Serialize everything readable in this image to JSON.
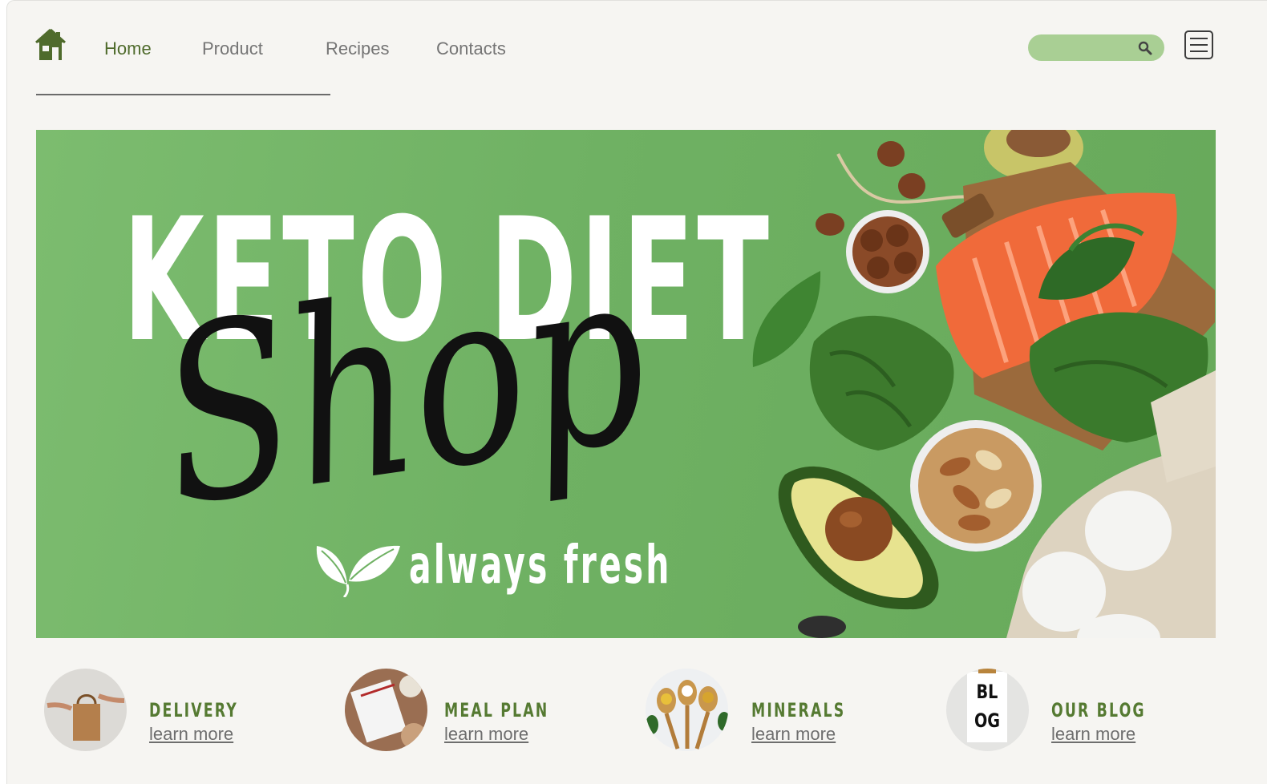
{
  "nav": {
    "links": [
      {
        "label": "Home",
        "active": true
      },
      {
        "label": "Product",
        "active": false
      },
      {
        "label": "Recipes",
        "active": false
      },
      {
        "label": "Contacts",
        "active": false
      }
    ]
  },
  "search": {
    "value": "",
    "placeholder": ""
  },
  "hero": {
    "title": "KETO DIET",
    "script": "Shop",
    "tagline": "always fresh"
  },
  "features": [
    {
      "title": "DELIVERY",
      "link": "learn more",
      "icon": "paper-bag-image"
    },
    {
      "title": "MEAL PLAN",
      "link": "learn more",
      "icon": "notebook-image"
    },
    {
      "title": "MINERALS",
      "link": "learn more",
      "icon": "supplement-spoons-image"
    },
    {
      "title": "OUR BLOG",
      "link": "learn more",
      "icon": "blog-card-image",
      "thumb_text_1": "BL",
      "thumb_text_2": "OG"
    }
  ],
  "colors": {
    "accent_green": "#4f6b2c",
    "feature_green": "#557a32",
    "search_green": "#a9cf94",
    "hero_green": "#6fb163",
    "page_bg": "#f6f5f2"
  }
}
